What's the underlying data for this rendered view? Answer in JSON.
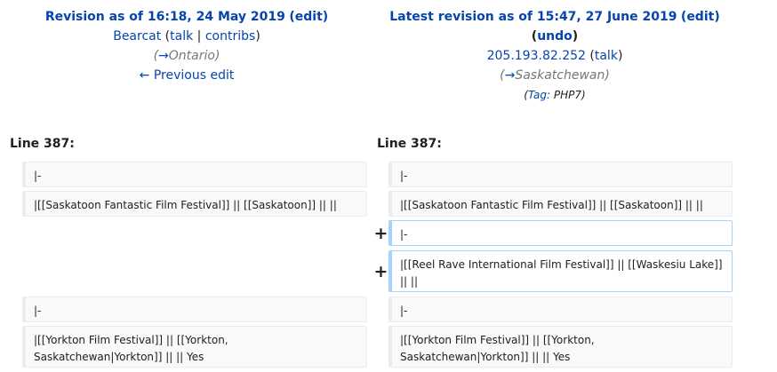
{
  "left_header": {
    "revision_prefix": "Revision as of 16:18, 24 May 2019",
    "edit_label": "edit",
    "user": "Bearcat",
    "talk": "talk",
    "contribs": "contribs",
    "summary_arrow": "→",
    "summary_section": "Ontario",
    "previous_edit": "← Previous edit"
  },
  "right_header": {
    "revision_prefix": "Latest revision as of 15:47, 27 June 2019",
    "edit_label": "edit",
    "undo_label": "undo",
    "user": "205.193.82.252",
    "talk": "talk",
    "summary_arrow": "→",
    "summary_section": "Saskatchewan",
    "tag_prefix": "Tag: ",
    "tag_name": "PHP7"
  },
  "line_numbers": {
    "left": "Line 387:",
    "right": "Line 387:"
  },
  "diff": {
    "left": [
      "|-",
      "|[[Saskatoon Fantastic Film Festival]] || [[Saskatoon]] || ||",
      "|-",
      "|[[Yorkton Film Festival]] || [[Yorkton, Saskatchewan|Yorkton]] || || Yes"
    ],
    "right": [
      "|-",
      "|[[Saskatoon Fantastic Film Festival]] || [[Saskatoon]] || ||",
      "|-",
      "|[[Reel Rave International Film Festival]] || [[Waskesiu Lake]] || ||",
      "|-",
      "|[[Yorkton Film Festival]] || [[Yorkton, Saskatchewan|Yorkton]] || || Yes"
    ],
    "added_marker": "+"
  }
}
